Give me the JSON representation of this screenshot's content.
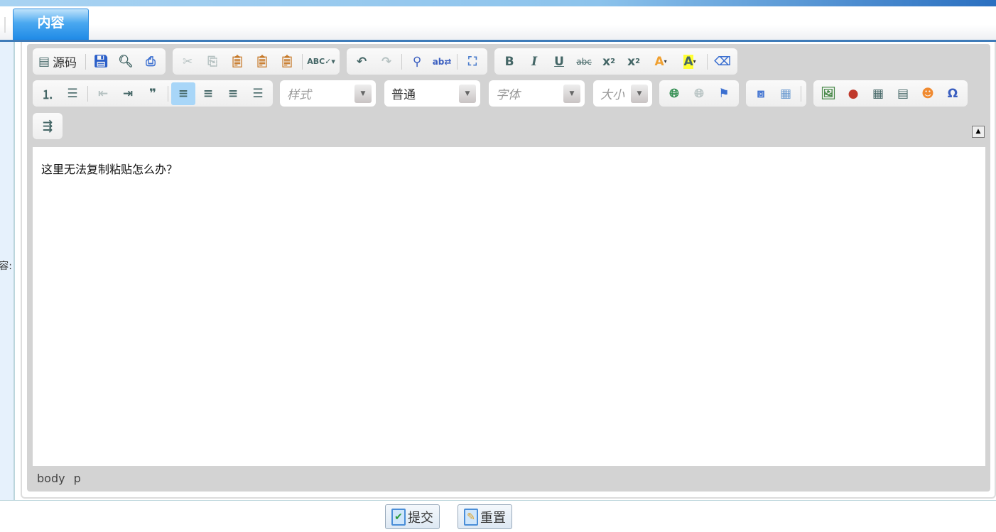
{
  "tab": {
    "label": "内容"
  },
  "left_label": "容:",
  "toolbar": {
    "source_label": "源码",
    "style_placeholder": "样式",
    "format_value": "普通",
    "font_placeholder": "字体",
    "size_placeholder": "大小"
  },
  "editor": {
    "content": "这里无法复制粘贴怎么办？",
    "path": [
      "body",
      "p"
    ]
  },
  "buttons": {
    "submit": "提交",
    "reset": "重置"
  },
  "colors": {
    "accent": "#1f8ae6",
    "toolbar_bg": "#d3d3d3",
    "active_button": "#a8d6f8"
  }
}
